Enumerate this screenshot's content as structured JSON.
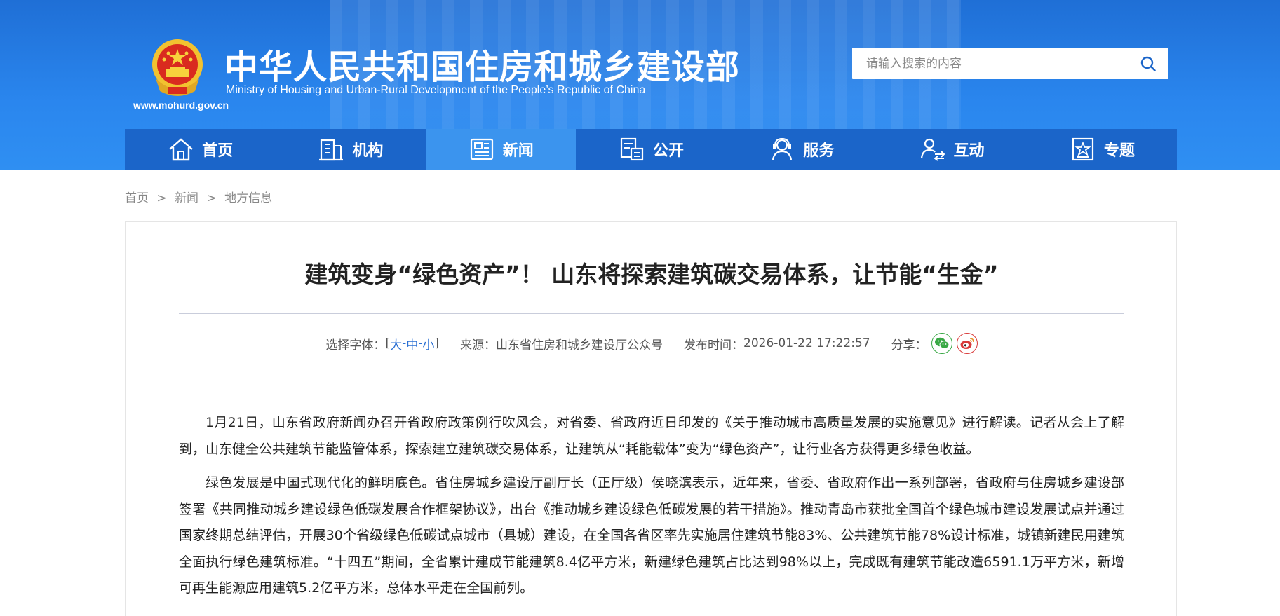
{
  "header": {
    "title_cn": "中华人民共和国住房和城乡建设部",
    "title_en": "Ministry of Housing and Urban-Rural Development of the People’s Republic of China",
    "site_url": "www.mohurd.gov.cn",
    "search": {
      "placeholder": "请输入搜索的内容",
      "value": ""
    }
  },
  "nav": {
    "items": [
      {
        "label": "首页",
        "icon": "home-icon"
      },
      {
        "label": "机构",
        "icon": "building-icon"
      },
      {
        "label": "新闻",
        "icon": "news-icon",
        "active": true
      },
      {
        "label": "公开",
        "icon": "public-info-icon"
      },
      {
        "label": "服务",
        "icon": "service-icon"
      },
      {
        "label": "互动",
        "icon": "interaction-icon"
      },
      {
        "label": "专题",
        "icon": "topic-star-icon"
      }
    ]
  },
  "breadcrumb": {
    "items": [
      "首页",
      "新闻",
      "地方信息"
    ],
    "separator": ">"
  },
  "article": {
    "title": "建筑变身“绿色资产”！ 山东将探索建筑碳交易体系，让节能“生金”",
    "meta": {
      "font_label": "选择字体：",
      "font_open": "[",
      "font_large": "大",
      "font_medium": "中",
      "font_small": "小",
      "font_dash": "-",
      "font_close": "]",
      "source_label": "来源：",
      "source": "山东省住房和城乡建设厅公众号",
      "time_label": "发布时间：",
      "time": "2026-01-22 17:22:57",
      "share_label": "分享："
    },
    "paragraphs": [
      "1月21日，山东省政府新闻办召开省政府政策例行吹风会，对省委、省政府近日印发的《关于推动城市高质量发展的实施意见》进行解读。记者从会上了解到，山东健全公共建筑节能监管体系，探索建立建筑碳交易体系，让建筑从“耗能载体”变为“绿色资产”，让行业各方获得更多绿色收益。",
      "绿色发展是中国式现代化的鲜明底色。省住房城乡建设厅副厅长（正厅级）侯晓滨表示，近年来，省委、省政府作出一系列部署，省政府与住房城乡建设部签署《共同推动城乡建设绿色低碳发展合作框架协议》，出台《推动城乡建设绿色低碳发展的若干措施》。推动青岛市获批全国首个绿色城市建设发展试点并通过国家终期总结评估，开展30个省级绿色低碳试点城市（县城）建设，在全国各省区率先实施居住建筑节能83%、公共建筑节能78%设计标准，城镇新建民用建筑全面执行绿色建筑标准。“十四五”期间，全省累计建成节能建筑8.4亿平方米，新建绿色建筑占比达到98%以上，完成既有建筑节能改造6591.1万平方米，新增可再生能源应用建筑5.2亿平方米，总体水平走在全国前列。"
    ]
  },
  "colors": {
    "header_blue": "#2a86ee",
    "nav_blue": "#1b65c9",
    "nav_active": "#3b94ee",
    "link_blue": "#2a6fd3",
    "wechat_green": "#39a845",
    "weibo_red": "#d93a3a"
  }
}
